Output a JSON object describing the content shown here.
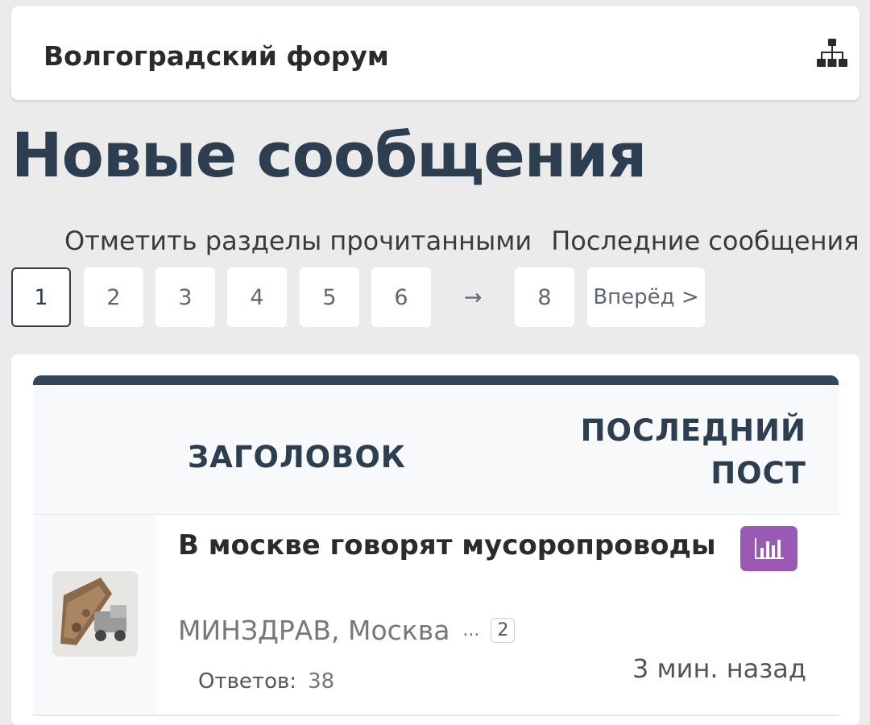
{
  "header": {
    "site_name": "Волгоградский форум",
    "icon": "sitemap-icon"
  },
  "page": {
    "title": "Новые сообщения"
  },
  "actions": {
    "mark_read": "Отметить разделы прочитанными",
    "latest_posts": "Последние сообщения"
  },
  "pagination": {
    "pages": [
      "1",
      "2",
      "3",
      "4",
      "5",
      "6"
    ],
    "ellipsis": "→",
    "last_page": "8",
    "next_label": "Вперёд >",
    "current": "1"
  },
  "table": {
    "headers": {
      "title": "ЗАГОЛОВОК",
      "last_post": "ПОСЛЕДНИЙ ПОСТ"
    },
    "rows": [
      {
        "title": "В москве говорят мусоропроводы",
        "author": "МИНЗДРАВ, Москва",
        "dots": "...",
        "page_badge": "2",
        "replies_label": "Ответов:",
        "replies": "38",
        "last_post_time": "3 мин. назад",
        "badge_icon": "poll-chart-icon",
        "accent_color": "#9b59b6"
      }
    ]
  }
}
